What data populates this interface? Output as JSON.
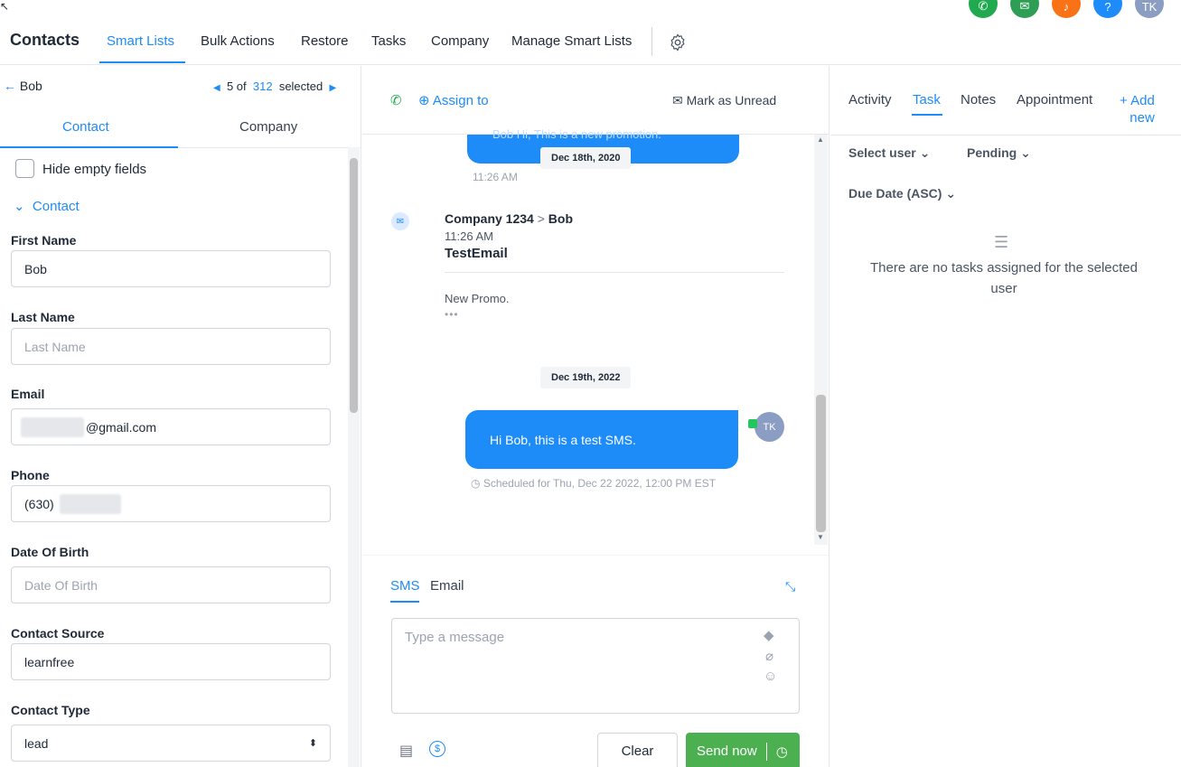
{
  "header": {
    "title": "Contacts",
    "nav": [
      "Smart Lists",
      "Bulk Actions",
      "Restore",
      "Tasks",
      "Company",
      "Manage Smart Lists"
    ],
    "avatar_initials": "TK",
    "colors": {
      "accent": "#1d8cf8",
      "phone": "#21a94f",
      "megaphone": "#2e9e54",
      "bell": "#f97316",
      "help": "#1d8cf8",
      "avatar": "#8b9dc3"
    }
  },
  "left": {
    "back_label": "Bob",
    "pager": {
      "current": "5",
      "of_label": "of",
      "total": "312",
      "selected_label": "selected"
    },
    "tabs": [
      "Contact",
      "Company"
    ],
    "hide_empty_label": "Hide empty fields",
    "section_label": "Contact",
    "fields": {
      "first_name": {
        "label": "First Name",
        "value": "Bob"
      },
      "last_name": {
        "label": "Last Name",
        "placeholder": "Last Name"
      },
      "email": {
        "label": "Email",
        "value": "@gmail.com"
      },
      "phone": {
        "label": "Phone",
        "value": "(630)"
      },
      "dob": {
        "label": "Date Of Birth",
        "placeholder": "Date Of Birth"
      },
      "source": {
        "label": "Contact Source",
        "value": "learnfree"
      },
      "type": {
        "label": "Contact Type",
        "value": "lead"
      }
    }
  },
  "middle": {
    "assign_label": "Assign to",
    "mark_unread_label": "Mark as Unread",
    "messages": {
      "top_bubble_text": "Bob Hi, This is a new promotion.",
      "date1": "Dec 18th, 2020",
      "time1": "11:26 AM",
      "email_from": "Company 1234",
      "email_sep": ">",
      "email_to": "Bob",
      "email_time": "11:26 AM",
      "email_subject": "TestEmail",
      "email_body": "New Promo.",
      "email_more": "•••",
      "date2": "Dec 19th, 2022",
      "sms_text": "Hi Bob, this is a test SMS.",
      "sms_avatar": "TK",
      "scheduled": "Scheduled for Thu, Dec 22 2022, 12:00 PM EST"
    },
    "compose": {
      "tabs": [
        "SMS",
        "Email"
      ],
      "placeholder": "Type a message",
      "clear_label": "Clear",
      "send_label": "Send now"
    }
  },
  "right": {
    "tabs": [
      "Activity",
      "Task",
      "Notes",
      "Appointment"
    ],
    "add_new_line1": "+ Add",
    "add_new_line2": "new",
    "select_user": "Select user",
    "status": "Pending",
    "sort": "Due Date (ASC)",
    "empty_message": "There are no tasks assigned for the selected user"
  }
}
